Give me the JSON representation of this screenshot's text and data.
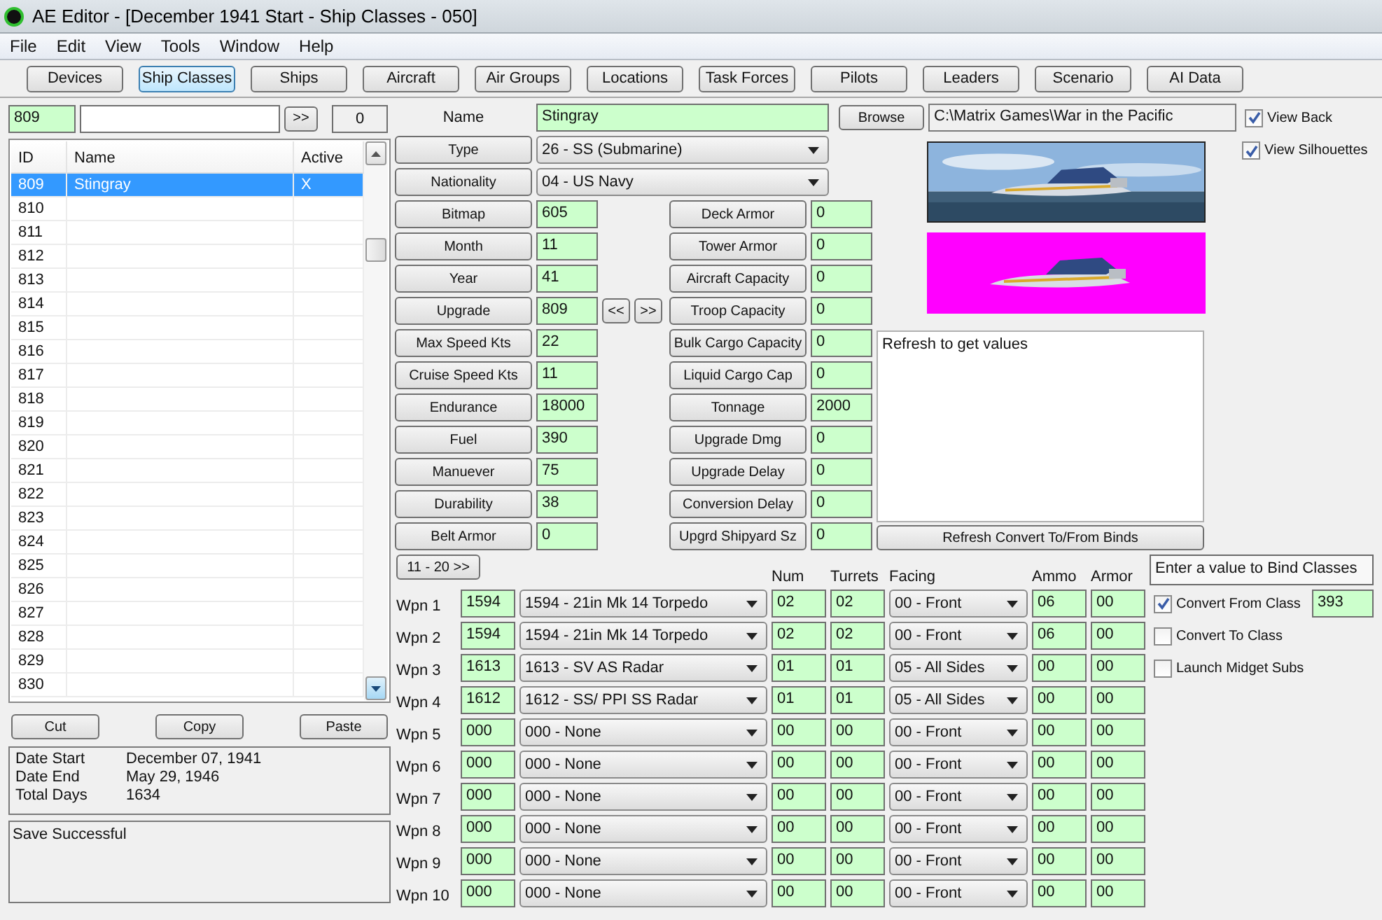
{
  "window": {
    "title": "AE Editor - [December 1941 Start - Ship Classes - 050]"
  },
  "menu": [
    "File",
    "Edit",
    "View",
    "Tools",
    "Window",
    "Help"
  ],
  "toolbar": [
    {
      "label": "Devices",
      "selected": false
    },
    {
      "label": "Ship Classes",
      "selected": true
    },
    {
      "label": "Ships",
      "selected": false
    },
    {
      "label": "Aircraft",
      "selected": false
    },
    {
      "label": "Air Groups",
      "selected": false
    },
    {
      "label": "Locations",
      "selected": false
    },
    {
      "label": "Task Forces",
      "selected": false
    },
    {
      "label": "Pilots",
      "selected": false
    },
    {
      "label": "Leaders",
      "selected": false
    },
    {
      "label": "Scenario",
      "selected": false
    },
    {
      "label": "AI Data",
      "selected": false
    }
  ],
  "class_list": {
    "id_field": "809",
    "go_button": ">>",
    "count": "0",
    "columns": [
      "ID",
      "Name",
      "Active"
    ],
    "rows": [
      {
        "id": "809",
        "name": "Stingray",
        "active": "X",
        "selected": true
      },
      {
        "id": "810",
        "selected": false
      },
      {
        "id": "811",
        "selected": false
      },
      {
        "id": "812",
        "selected": false
      },
      {
        "id": "813",
        "selected": false
      },
      {
        "id": "814",
        "selected": false
      },
      {
        "id": "815",
        "selected": false
      },
      {
        "id": "816",
        "selected": false
      },
      {
        "id": "817",
        "selected": false
      },
      {
        "id": "818",
        "selected": false
      },
      {
        "id": "819",
        "selected": false
      },
      {
        "id": "820",
        "selected": false
      },
      {
        "id": "821",
        "selected": false
      },
      {
        "id": "822",
        "selected": false
      },
      {
        "id": "823",
        "selected": false
      },
      {
        "id": "824",
        "selected": false
      },
      {
        "id": "825",
        "selected": false
      },
      {
        "id": "826",
        "selected": false
      },
      {
        "id": "827",
        "selected": false
      },
      {
        "id": "828",
        "selected": false
      },
      {
        "id": "829",
        "selected": false
      },
      {
        "id": "830",
        "selected": false
      }
    ]
  },
  "clipboard_buttons": [
    "Cut",
    "Copy",
    "Paste"
  ],
  "dates": [
    {
      "label": "Date Start",
      "value": "December 07, 1941"
    },
    {
      "label": "Date End",
      "value": "May 29, 1946"
    },
    {
      "label": "Total Days",
      "value": "1634"
    }
  ],
  "status": "Save Successful",
  "form": {
    "name_label": "Name",
    "name": "Stingray",
    "type_button": "Type",
    "type": "26 - SS (Submarine)",
    "nationality_button": "Nationality",
    "nationality": "04 - US Navy",
    "left_fields": [
      {
        "label": "Bitmap",
        "value": "605"
      },
      {
        "label": "Month",
        "value": "11"
      },
      {
        "label": "Year",
        "value": "41"
      },
      {
        "label": "Upgrade",
        "value": "809",
        "nav": [
          "<<",
          ">>"
        ]
      },
      {
        "label": "Max Speed Kts",
        "value": "22"
      },
      {
        "label": "Cruise Speed Kts",
        "value": "11"
      },
      {
        "label": "Endurance",
        "value": "18000"
      },
      {
        "label": "Fuel",
        "value": "390"
      },
      {
        "label": "Manuever",
        "value": "75"
      },
      {
        "label": "Durability",
        "value": "38"
      },
      {
        "label": "Belt Armor",
        "value": "0"
      }
    ],
    "right_fields": [
      {
        "label": "Deck Armor",
        "value": "0"
      },
      {
        "label": "Tower Armor",
        "value": "0"
      },
      {
        "label": "Aircraft Capacity",
        "value": "0"
      },
      {
        "label": "Troop Capacity",
        "value": "0"
      },
      {
        "label": "Bulk Cargo Capacity",
        "value": "0"
      },
      {
        "label": "Liquid Cargo Cap",
        "value": "0"
      },
      {
        "label": "Tonnage",
        "value": "2000"
      },
      {
        "label": "Upgrade Dmg",
        "value": "0"
      },
      {
        "label": "Upgrade Delay",
        "value": "0"
      },
      {
        "label": "Conversion Delay",
        "value": "0"
      },
      {
        "label": "Upgrd Shipyard Sz",
        "value": "0"
      }
    ]
  },
  "image": {
    "browse": "Browse",
    "path": "C:\\Matrix Games\\War in the Pacific",
    "view_back": {
      "label": "View Back",
      "checked": true
    },
    "view_silhouettes": {
      "label": "View Silhouettes",
      "checked": true
    }
  },
  "binds": {
    "text": "Refresh to get values",
    "refresh_button": "Refresh Convert To/From Binds"
  },
  "weapons": {
    "page_button": "11 - 20 >>",
    "columns": [
      "Num",
      "Turrets",
      "Facing",
      "Ammo",
      "Armor"
    ],
    "rows": [
      {
        "label": "Wpn 1",
        "id": "1594",
        "device": "1594 - 21in Mk 14 Torpedo",
        "num": "02",
        "turrets": "02",
        "facing": "00 - Front",
        "ammo": "06",
        "armor": "00"
      },
      {
        "label": "Wpn 2",
        "id": "1594",
        "device": "1594 - 21in Mk 14 Torpedo",
        "num": "02",
        "turrets": "02",
        "facing": "00 - Front",
        "ammo": "06",
        "armor": "00"
      },
      {
        "label": "Wpn 3",
        "id": "1613",
        "device": "1613 - SV AS Radar",
        "num": "01",
        "turrets": "01",
        "facing": "05 - All Sides",
        "ammo": "00",
        "armor": "00"
      },
      {
        "label": "Wpn 4",
        "id": "1612",
        "device": "1612 - SS/ PPI SS Radar",
        "num": "01",
        "turrets": "01",
        "facing": "05 - All Sides",
        "ammo": "00",
        "armor": "00"
      },
      {
        "label": "Wpn 5",
        "id": "000",
        "device": "000 - None",
        "num": "00",
        "turrets": "00",
        "facing": "00 - Front",
        "ammo": "00",
        "armor": "00"
      },
      {
        "label": "Wpn 6",
        "id": "000",
        "device": "000 - None",
        "num": "00",
        "turrets": "00",
        "facing": "00 - Front",
        "ammo": "00",
        "armor": "00"
      },
      {
        "label": "Wpn 7",
        "id": "000",
        "device": "000 - None",
        "num": "00",
        "turrets": "00",
        "facing": "00 - Front",
        "ammo": "00",
        "armor": "00"
      },
      {
        "label": "Wpn 8",
        "id": "000",
        "device": "000 - None",
        "num": "00",
        "turrets": "00",
        "facing": "00 - Front",
        "ammo": "00",
        "armor": "00"
      },
      {
        "label": "Wpn 9",
        "id": "000",
        "device": "000 - None",
        "num": "00",
        "turrets": "00",
        "facing": "00 - Front",
        "ammo": "00",
        "armor": "00"
      },
      {
        "label": "Wpn 10",
        "id": "000",
        "device": "000 - None",
        "num": "00",
        "turrets": "00",
        "facing": "00 - Front",
        "ammo": "00",
        "armor": "00"
      }
    ]
  },
  "bind_classes": {
    "title": "Enter a value to Bind Classes",
    "options": [
      {
        "label": "Convert From Class",
        "checked": true,
        "value": "393"
      },
      {
        "label": "Convert To Class",
        "checked": false
      },
      {
        "label": "Launch Midget Subs",
        "checked": false
      }
    ]
  }
}
